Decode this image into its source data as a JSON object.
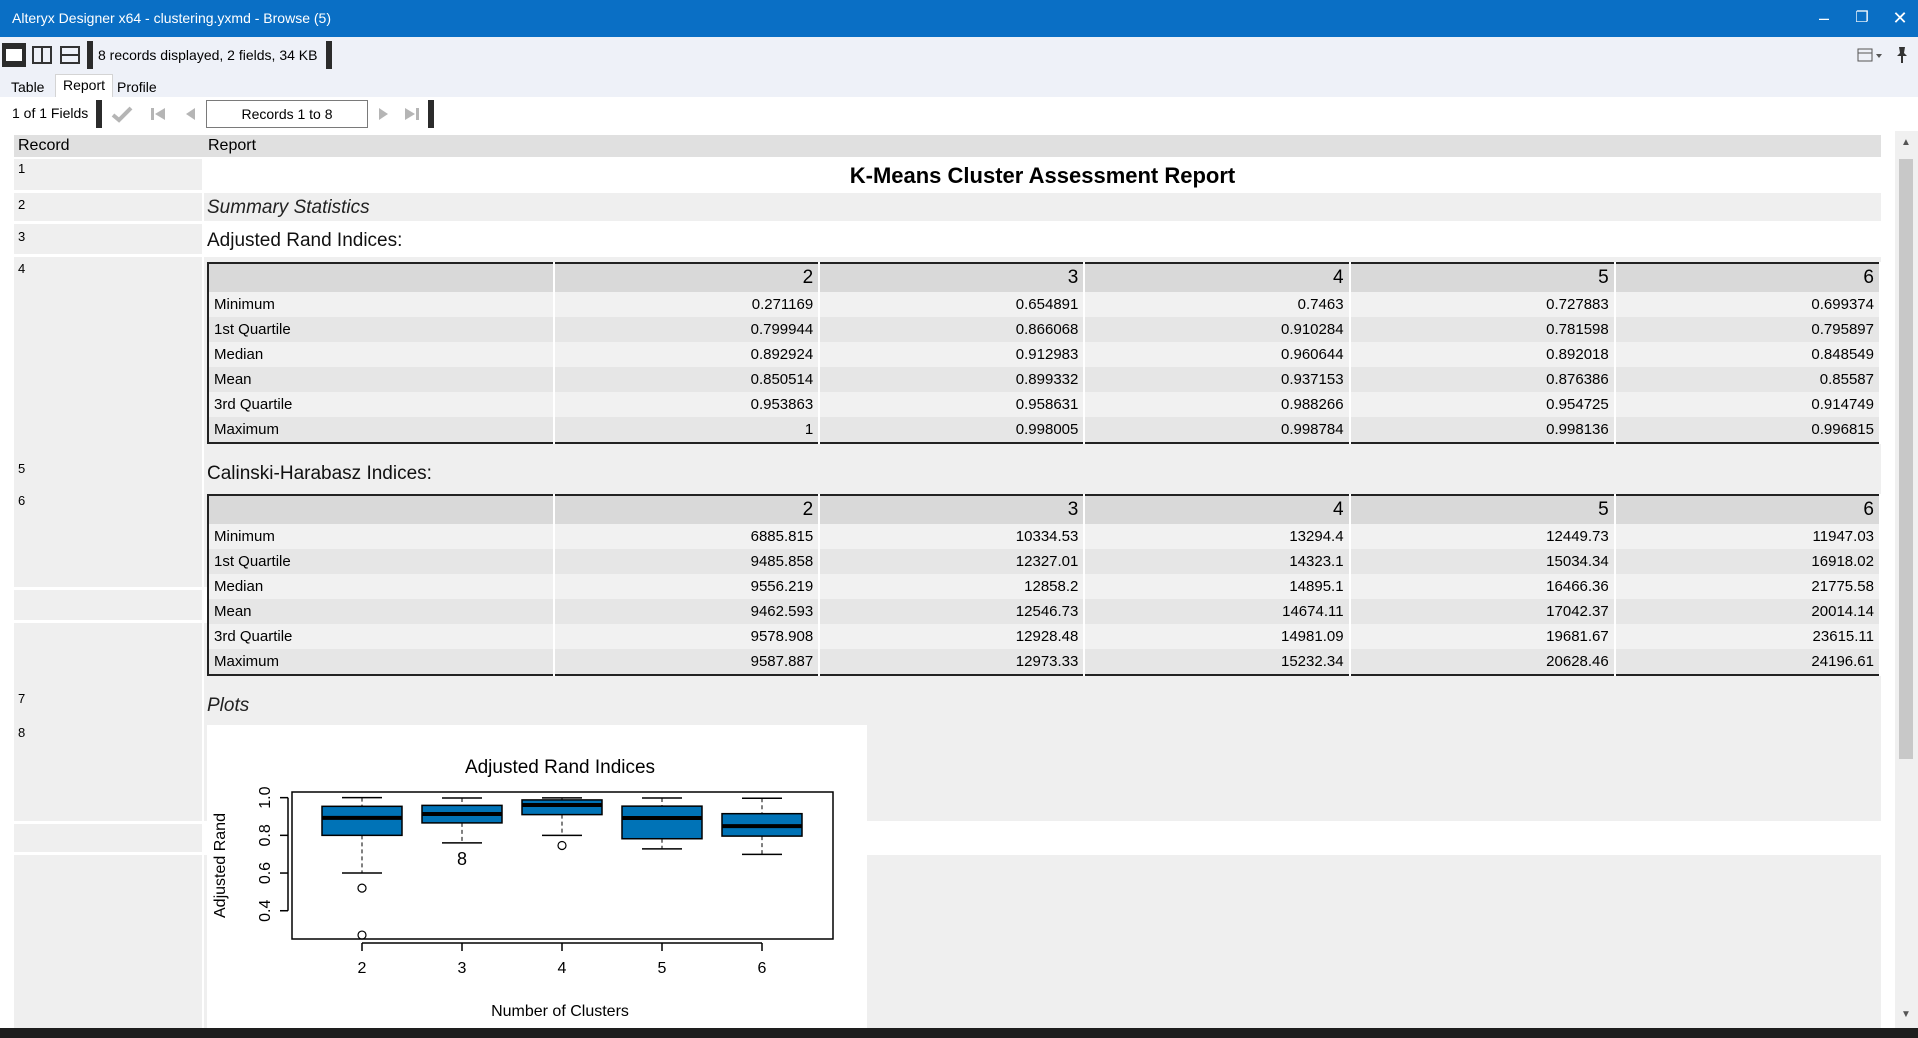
{
  "window": {
    "title": "Alteryx Designer x64 - clustering.yxmd - Browse (5)"
  },
  "toolbar": {
    "record_info": "8 records displayed, 2 fields, 34 KB"
  },
  "tabs": [
    {
      "label": "Table"
    },
    {
      "label": "Report"
    },
    {
      "label": "Profile"
    }
  ],
  "nav": {
    "fields": "1 of 1 Fields",
    "records": "Records 1 to 8"
  },
  "grid": {
    "col_record": "Record",
    "col_report": "Report"
  },
  "records": [
    "1",
    "2",
    "3",
    "4",
    "5",
    "6",
    "7",
    "8"
  ],
  "report": {
    "title": "K-Means Cluster Assessment Report",
    "summary": "Summary Statistics",
    "ari_label": "Adjusted Rand Indices:",
    "ch_label": "Calinski-Harabasz Indices:",
    "plots": "Plots"
  },
  "ari_table": {
    "headers": [
      "",
      "2",
      "3",
      "4",
      "5",
      "6"
    ],
    "rows": [
      [
        "Minimum",
        "0.271169",
        "0.654891",
        "0.7463",
        "0.727883",
        "0.699374"
      ],
      [
        "1st Quartile",
        "0.799944",
        "0.866068",
        "0.910284",
        "0.781598",
        "0.795897"
      ],
      [
        "Median",
        "0.892924",
        "0.912983",
        "0.960644",
        "0.892018",
        "0.848549"
      ],
      [
        "Mean",
        "0.850514",
        "0.899332",
        "0.937153",
        "0.876386",
        "0.85587"
      ],
      [
        "3rd Quartile",
        "0.953863",
        "0.958631",
        "0.988266",
        "0.954725",
        "0.914749"
      ],
      [
        "Maximum",
        "1",
        "0.998005",
        "0.998784",
        "0.998136",
        "0.996815"
      ]
    ]
  },
  "ch_table": {
    "headers": [
      "",
      "2",
      "3",
      "4",
      "5",
      "6"
    ],
    "rows": [
      [
        "Minimum",
        "6885.815",
        "10334.53",
        "13294.4",
        "12449.73",
        "11947.03"
      ],
      [
        "1st Quartile",
        "9485.858",
        "12327.01",
        "14323.1",
        "15034.34",
        "16918.02"
      ],
      [
        "Median",
        "9556.219",
        "12858.2",
        "14895.1",
        "16466.36",
        "21775.58"
      ],
      [
        "Mean",
        "9462.593",
        "12546.73",
        "14674.11",
        "17042.37",
        "20014.14"
      ],
      [
        "3rd Quartile",
        "9578.908",
        "12928.48",
        "14981.09",
        "19681.67",
        "23615.11"
      ],
      [
        "Maximum",
        "9587.887",
        "12973.33",
        "15232.34",
        "20628.46",
        "24196.61"
      ]
    ]
  },
  "chart_data": {
    "type": "boxplot",
    "title": "Adjusted Rand Indices",
    "xlabel": "Number of Clusters",
    "ylabel": "Adjusted Rand",
    "categories": [
      "2",
      "3",
      "4",
      "5",
      "6"
    ],
    "yticks": [
      "0.4",
      "0.6",
      "0.8",
      "1.0"
    ],
    "ylim": [
      0.25,
      1.03
    ],
    "box_color": "#0073b7",
    "boxes": [
      {
        "x": "2",
        "whisker_low": 0.6,
        "q1": 0.8,
        "median": 0.893,
        "q3": 0.954,
        "whisker_high": 1.0,
        "outliers": [
          0.52,
          0.271
        ]
      },
      {
        "x": "3",
        "whisker_low": 0.76,
        "q1": 0.866,
        "median": 0.913,
        "q3": 0.959,
        "whisker_high": 0.998,
        "outliers": [],
        "outlier_labels": [
          "8"
        ]
      },
      {
        "x": "4",
        "whisker_low": 0.8,
        "q1": 0.91,
        "median": 0.961,
        "q3": 0.988,
        "whisker_high": 0.999,
        "outliers": [
          0.7463
        ]
      },
      {
        "x": "5",
        "whisker_low": 0.728,
        "q1": 0.782,
        "median": 0.892,
        "q3": 0.955,
        "whisker_high": 0.998,
        "outliers": []
      },
      {
        "x": "6",
        "whisker_low": 0.699,
        "q1": 0.796,
        "median": 0.849,
        "q3": 0.915,
        "whisker_high": 0.997,
        "outliers": []
      }
    ]
  }
}
